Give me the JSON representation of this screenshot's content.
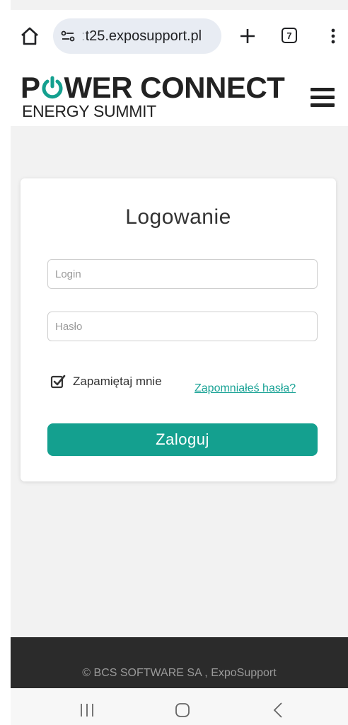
{
  "browser": {
    "url_faded": ":",
    "url_main": "t25.exposupport.pl",
    "tab_count": "7"
  },
  "site": {
    "logo_line1_start": "P",
    "logo_line1_end": "WER CONNECT",
    "logo_line2": "ENERGY SUMMIT"
  },
  "login": {
    "title": "Logowanie",
    "login_placeholder": "Login",
    "login_value": "",
    "password_placeholder": "Hasło",
    "password_value": "",
    "remember_label": "Zapamiętaj mnie",
    "remember_checked": true,
    "forgot_link": "Zapomniałeś hasła?",
    "submit_label": "Zaloguj"
  },
  "footer": {
    "text": "© BCS SOFTWARE SA , ExpoSupport"
  },
  "colors": {
    "accent": "#14a08f",
    "link": "#1aa396",
    "footer_bg": "#2b2b2b"
  }
}
